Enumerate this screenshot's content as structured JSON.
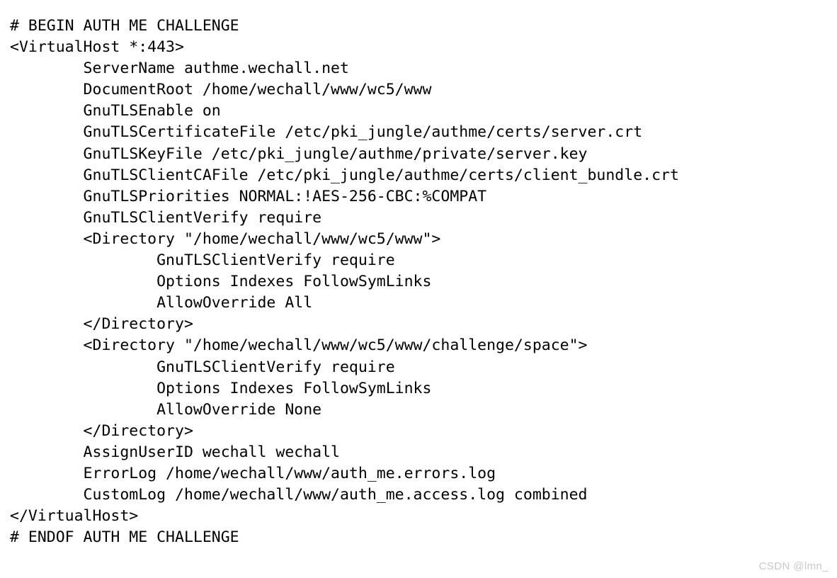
{
  "document": {
    "kind": "apache-virtualhost-config",
    "font_size_px": 21.5,
    "line_height_px": 30.1,
    "text_color": "#000000",
    "background_color": "#ffffff",
    "indent_unit_spaces": 8,
    "lines": [
      "# BEGIN AUTH ME CHALLENGE",
      "<VirtualHost *:443>",
      "        ServerName authme.wechall.net",
      "        DocumentRoot /home/wechall/www/wc5/www",
      "        GnuTLSEnable on",
      "        GnuTLSCertificateFile /etc/pki_jungle/authme/certs/server.crt",
      "        GnuTLSKeyFile /etc/pki_jungle/authme/private/server.key",
      "        GnuTLSClientCAFile /etc/pki_jungle/authme/certs/client_bundle.crt",
      "        GnuTLSPriorities NORMAL:!AES-256-CBC:%COMPAT",
      "        GnuTLSClientVerify require",
      "        <Directory \"/home/wechall/www/wc5/www\">",
      "                GnuTLSClientVerify require",
      "                Options Indexes FollowSymLinks",
      "                AllowOverride All",
      "        </Directory>",
      "        <Directory \"/home/wechall/www/wc5/www/challenge/space\">",
      "                GnuTLSClientVerify require",
      "                Options Indexes FollowSymLinks",
      "                AllowOverride None",
      "        </Directory>",
      "        AssignUserID wechall wechall",
      "        ErrorLog /home/wechall/www/auth_me.errors.log",
      "        CustomLog /home/wechall/www/auth_me.access.log combined",
      "</VirtualHost>",
      "# ENDOF AUTH ME CHALLENGE"
    ]
  },
  "watermark": {
    "text": "CSDN @lmn_",
    "color": "#c9c9c9"
  }
}
